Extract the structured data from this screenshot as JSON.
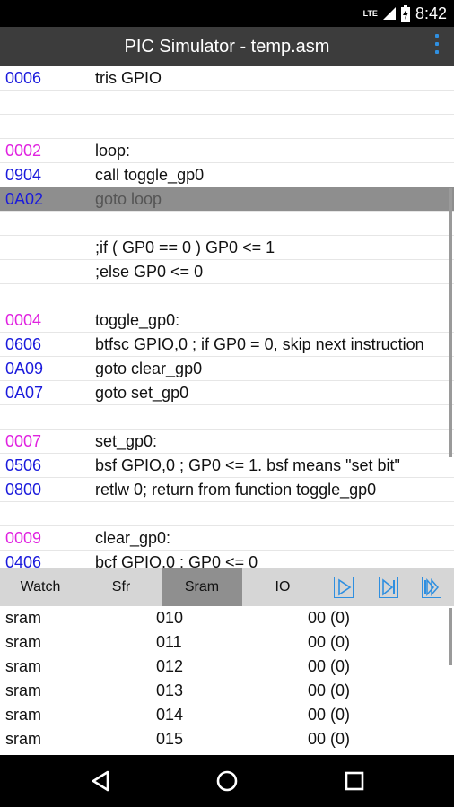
{
  "status": {
    "time": "8:42",
    "network": "LTE"
  },
  "app": {
    "title": "PIC Simulator - temp.asm"
  },
  "colors": {
    "label_addr": "#e022e0",
    "opcode_addr": "#1a1adc",
    "accent": "#2f8fe0"
  },
  "code": [
    {
      "addr": "0006",
      "kind": "opcode",
      "text": "tris GPIO"
    },
    {
      "addr": "",
      "kind": "",
      "text": ""
    },
    {
      "addr": "",
      "kind": "",
      "text": ""
    },
    {
      "addr": "0002",
      "kind": "label",
      "text": "loop:"
    },
    {
      "addr": "0904",
      "kind": "opcode",
      "text": "call toggle_gp0"
    },
    {
      "addr": "0A02",
      "kind": "opcode",
      "text": "goto loop",
      "selected": true
    },
    {
      "addr": "",
      "kind": "",
      "text": ""
    },
    {
      "addr": "",
      "kind": "",
      "text": ";if ( GP0 == 0 ) GP0 <= 1"
    },
    {
      "addr": "",
      "kind": "",
      "text": ";else GP0 <= 0"
    },
    {
      "addr": "",
      "kind": "",
      "text": ""
    },
    {
      "addr": "0004",
      "kind": "label",
      "text": "toggle_gp0:"
    },
    {
      "addr": "0606",
      "kind": "opcode",
      "text": "btfsc GPIO,0 ; if GP0 = 0, skip next instruction"
    },
    {
      "addr": "0A09",
      "kind": "opcode",
      "text": "goto clear_gp0"
    },
    {
      "addr": "0A07",
      "kind": "opcode",
      "text": "goto set_gp0"
    },
    {
      "addr": "",
      "kind": "",
      "text": ""
    },
    {
      "addr": "0007",
      "kind": "label",
      "text": "set_gp0:"
    },
    {
      "addr": "0506",
      "kind": "opcode",
      "text": "bsf GPIO,0 ; GP0 <= 1. bsf means \"set bit\""
    },
    {
      "addr": "0800",
      "kind": "opcode",
      "text": "retlw 0; return from function toggle_gp0"
    },
    {
      "addr": "",
      "kind": "",
      "text": ""
    },
    {
      "addr": "0009",
      "kind": "label",
      "text": "clear_gp0:"
    },
    {
      "addr": "0406",
      "kind": "opcode",
      "text": "bcf GPIO,0 ; GP0 <= 0"
    }
  ],
  "tabs": [
    {
      "label": "Watch"
    },
    {
      "label": "Sfr"
    },
    {
      "label": "Sram",
      "active": true
    },
    {
      "label": "IO"
    }
  ],
  "controls": [
    {
      "icon": "play-icon"
    },
    {
      "icon": "step-icon"
    },
    {
      "icon": "fast-forward-icon"
    }
  ],
  "registers": [
    {
      "name": "sram",
      "address": "010",
      "value": "00 (0)"
    },
    {
      "name": "sram",
      "address": "011",
      "value": "00 (0)"
    },
    {
      "name": "sram",
      "address": "012",
      "value": "00 (0)"
    },
    {
      "name": "sram",
      "address": "013",
      "value": "00 (0)"
    },
    {
      "name": "sram",
      "address": "014",
      "value": "00 (0)"
    },
    {
      "name": "sram",
      "address": "015",
      "value": "00 (0)"
    }
  ],
  "nav": [
    {
      "icon": "back-icon"
    },
    {
      "icon": "home-icon"
    },
    {
      "icon": "recents-icon"
    }
  ]
}
